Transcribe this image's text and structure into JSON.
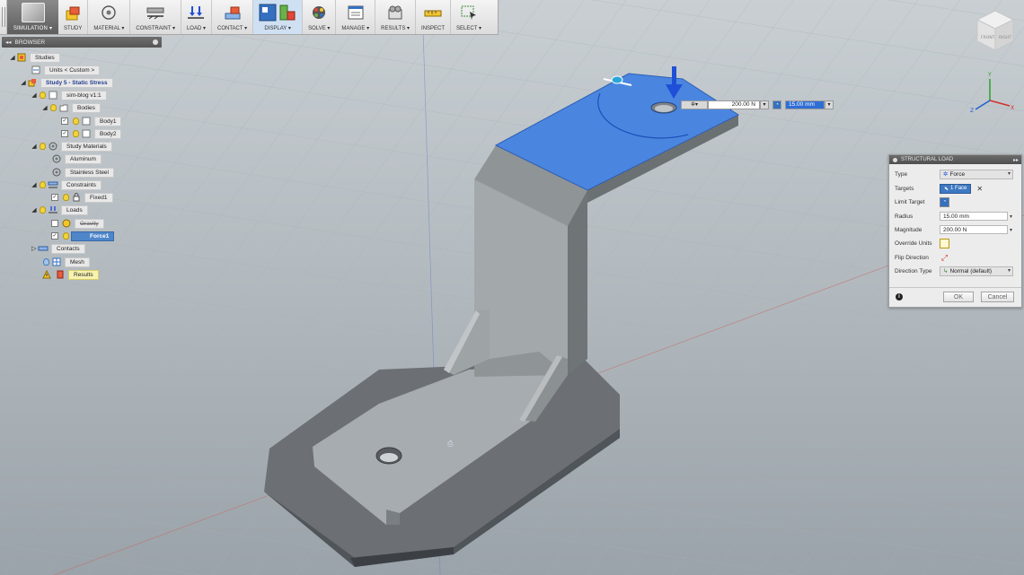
{
  "toolbar": {
    "workspace": "SIMULATION",
    "groups": [
      "STUDY",
      "MATERIAL",
      "CONSTRAINT",
      "LOAD",
      "CONTACT",
      "DISPLAY",
      "SOLVE",
      "MANAGE",
      "RESULTS",
      "INSPECT",
      "SELECT"
    ],
    "dropdown_arrow": "▾"
  },
  "browser": {
    "title": "BROWSER",
    "items": [
      {
        "label": "Studies"
      },
      {
        "label": "Units < Custom >"
      },
      {
        "label": "Study 5 - Static Stress"
      },
      {
        "label": "sim-blog v1:1"
      },
      {
        "label": "Bodies"
      },
      {
        "label": "Body1"
      },
      {
        "label": "Body2"
      },
      {
        "label": "Study Materials"
      },
      {
        "label": "Aluminum"
      },
      {
        "label": "Stainless Steel"
      },
      {
        "label": "Constraints"
      },
      {
        "label": "Fixed1"
      },
      {
        "label": "Loads"
      },
      {
        "label": "Gravity"
      },
      {
        "label": "Force1"
      },
      {
        "label": "Contacts"
      },
      {
        "label": "Mesh"
      },
      {
        "label": "Results"
      }
    ]
  },
  "manipulator": {
    "force_value": "200.00 N",
    "radius_value": "15.00 mm"
  },
  "structural_load": {
    "title": "STRUCTURAL LOAD",
    "rows": {
      "type_label": "Type",
      "type_value": "Force",
      "targets_label": "Targets",
      "targets_value": "1 Face",
      "limit_target_label": "Limit Target",
      "radius_label": "Radius",
      "radius_value": "15.00 mm",
      "magnitude_label": "Magnitude",
      "magnitude_value": "200.00 N",
      "override_units_label": "Override Units",
      "flip_direction_label": "Flip Direction",
      "direction_type_label": "Direction Type",
      "direction_type_value": "Normal (default)"
    },
    "ok_label": "OK",
    "cancel_label": "Cancel"
  },
  "viewcube": {
    "face_front": "FRONT",
    "face_right": "RIGHT"
  },
  "colors": {
    "selected_face": "#4a86e0",
    "model_grey": "#8e9396",
    "background": "#b4bcc2",
    "arrow": "#1f4fd6"
  }
}
